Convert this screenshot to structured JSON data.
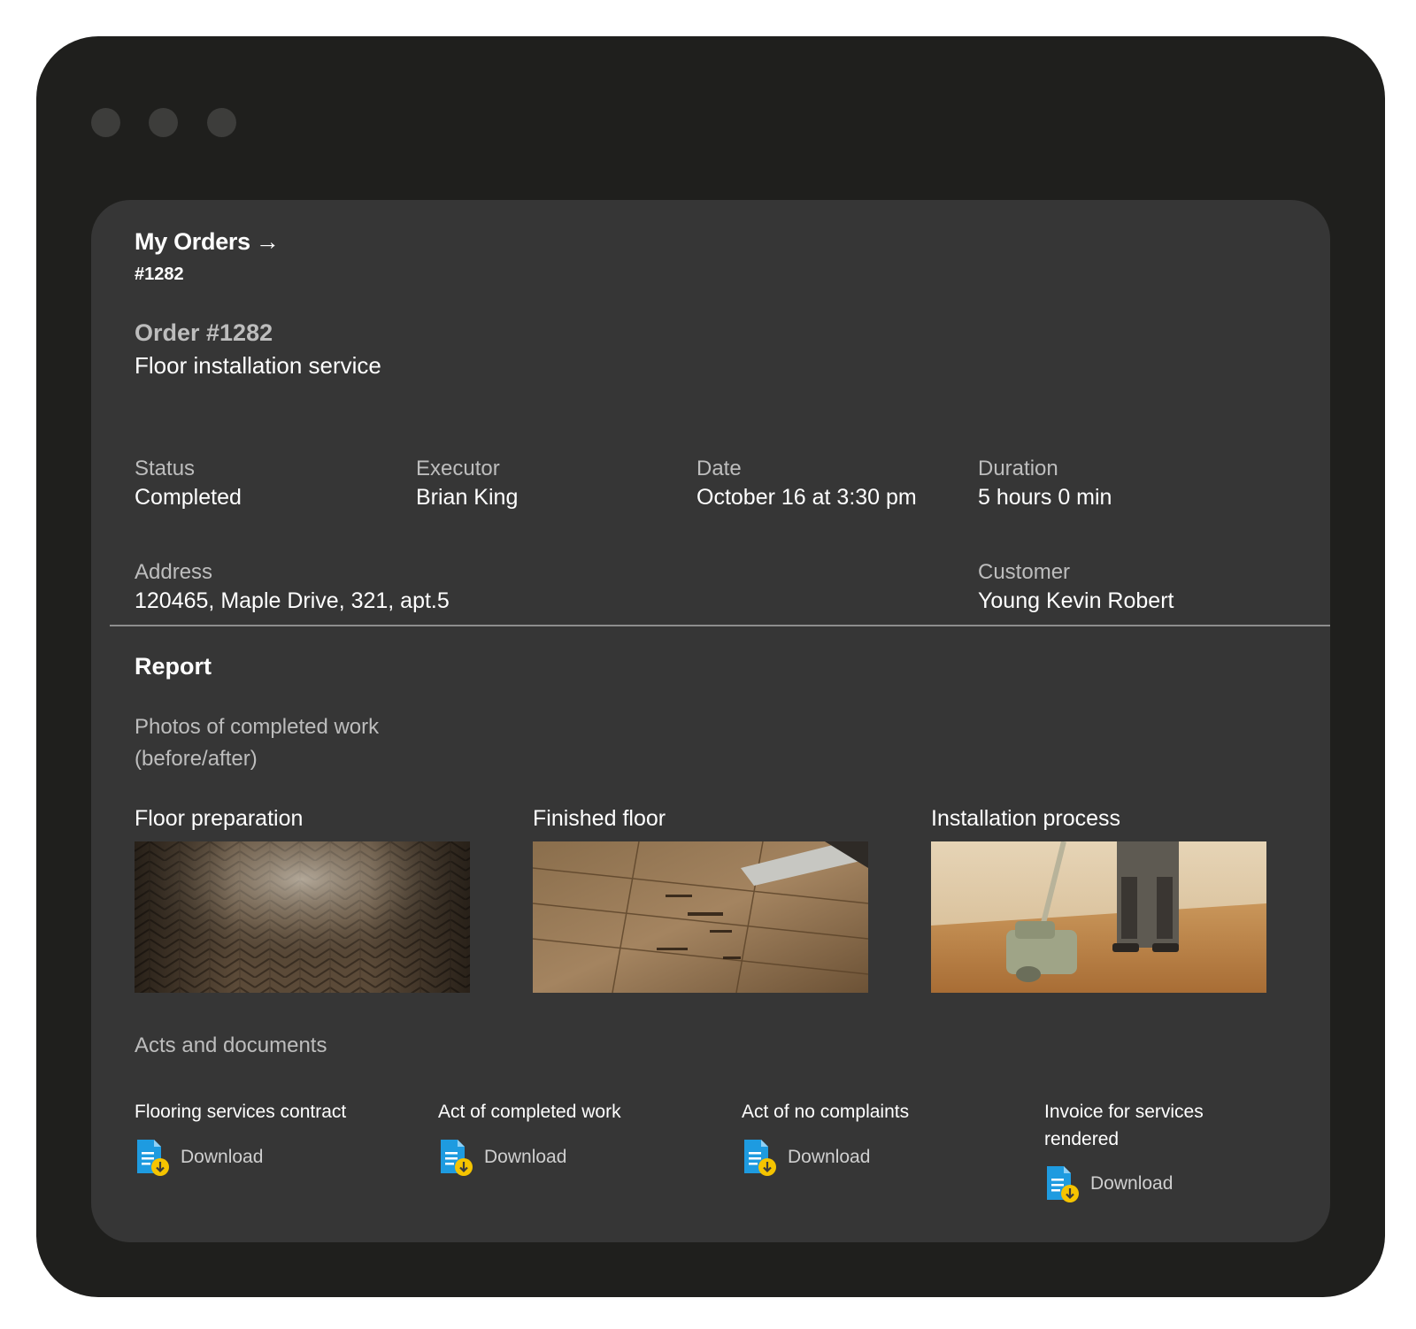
{
  "breadcrumb": {
    "link_label": "My Orders",
    "arrow": "→",
    "current": "#1282"
  },
  "order": {
    "number_label": "Order #1282",
    "service": "Floor installation service"
  },
  "details": {
    "status": {
      "label": "Status",
      "value": "Completed"
    },
    "executor": {
      "label": "Executor",
      "value": "Brian King"
    },
    "date": {
      "label": "Date",
      "value": "October 16 at 3:30 pm"
    },
    "duration": {
      "label": "Duration",
      "value": "5 hours 0 min"
    },
    "address": {
      "label": "Address",
      "value": "120465, Maple Drive, 321, apt.5"
    },
    "customer": {
      "label": "Customer",
      "value": "Young Kevin Robert"
    }
  },
  "report": {
    "title": "Report",
    "photos_subtitle": "Photos of completed work (before/after)",
    "photos": [
      {
        "caption": "Floor preparation",
        "icon": "parquet-photo"
      },
      {
        "caption": "Finished floor",
        "icon": "scraped-wood-photo"
      },
      {
        "caption": "Installation process",
        "icon": "floor-sander-photo"
      }
    ],
    "acts_title": "Acts and documents",
    "documents": [
      {
        "name": "Flooring services contract",
        "action": "Download",
        "icon": "document-download-icon"
      },
      {
        "name": "Act of completed work",
        "action": "Download",
        "icon": "document-download-icon"
      },
      {
        "name": "Act of no complaints",
        "action": "Download",
        "icon": "document-download-icon"
      },
      {
        "name": "Invoice for services rendered",
        "action": "Download",
        "icon": "document-download-icon"
      }
    ]
  },
  "colors": {
    "window_bg": "#1f1f1d",
    "panel_bg": "#363636",
    "muted_text": "#bdbdbd",
    "doc_icon_blue": "#1e9be0",
    "doc_icon_yellow": "#f5c400"
  }
}
